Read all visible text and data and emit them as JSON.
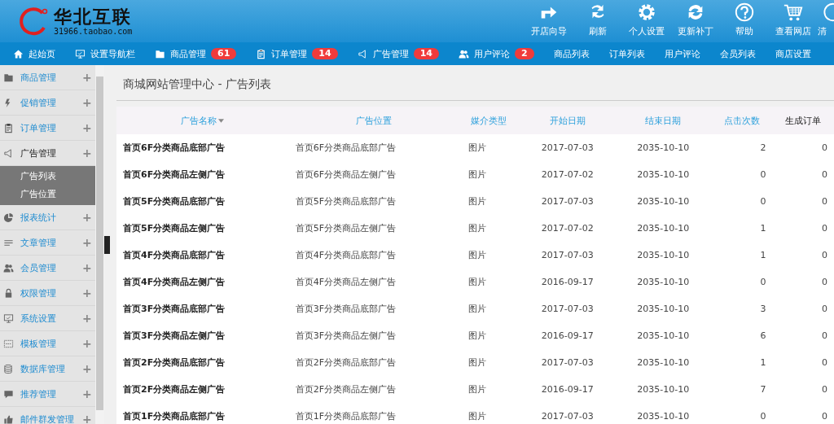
{
  "logo": {
    "name": "华北互联",
    "subtitle": "31966.taobao.com"
  },
  "toolbar": [
    {
      "kind": "guide",
      "label": "开店向导"
    },
    {
      "kind": "refresh",
      "label": "刷新"
    },
    {
      "kind": "settings",
      "label": "个人设置"
    },
    {
      "kind": "update",
      "label": "更新补丁"
    },
    {
      "kind": "help",
      "label": "帮助"
    },
    {
      "kind": "cart",
      "label": "查看网店"
    },
    {
      "kind": "clear",
      "label": "清"
    }
  ],
  "nav": [
    {
      "kind": "home",
      "label": "起始页"
    },
    {
      "kind": "screen",
      "label": "设置导航栏"
    },
    {
      "kind": "folder",
      "label": "商品管理",
      "badge": "61"
    },
    {
      "kind": "clipboard",
      "label": "订单管理",
      "badge": "14"
    },
    {
      "kind": "speaker",
      "label": "广告管理",
      "badge": "14"
    },
    {
      "kind": "users",
      "label": "用户评论",
      "badge": "2"
    },
    {
      "kind": "none",
      "label": "商品列表"
    },
    {
      "kind": "none",
      "label": "订单列表"
    },
    {
      "kind": "none",
      "label": "用户评论"
    },
    {
      "kind": "none",
      "label": "会员列表"
    },
    {
      "kind": "none",
      "label": "商店设置"
    }
  ],
  "sidebar": {
    "items": [
      {
        "kind": "folder",
        "label": "商品管理",
        "expanded": false
      },
      {
        "kind": "bolt",
        "label": "促销管理",
        "expanded": false
      },
      {
        "kind": "clipboard",
        "label": "订单管理",
        "expanded": false
      },
      {
        "kind": "speaker",
        "label": "广告管理",
        "expanded": true,
        "children": [
          {
            "label": "广告列表"
          },
          {
            "label": "广告位置"
          }
        ]
      },
      {
        "kind": "pie",
        "label": "报表统计",
        "expanded": false
      },
      {
        "kind": "lines",
        "label": "文章管理",
        "expanded": false
      },
      {
        "kind": "users",
        "label": "会员管理",
        "expanded": false
      },
      {
        "kind": "lock",
        "label": "权限管理",
        "expanded": false
      },
      {
        "kind": "screen",
        "label": "系统设置",
        "expanded": false
      },
      {
        "kind": "template",
        "label": "模板管理",
        "expanded": false
      },
      {
        "kind": "database",
        "label": "数据库管理",
        "expanded": false
      },
      {
        "kind": "chat",
        "label": "推荐管理",
        "expanded": false
      },
      {
        "kind": "thumb",
        "label": "邮件群发管理",
        "expanded": false
      }
    ],
    "toggle": "+"
  },
  "breadcrumb": "商城网站管理中心 - 广告列表",
  "table": {
    "columns": [
      {
        "label": "广告名称",
        "link": true,
        "sorted": true
      },
      {
        "label": "广告位置",
        "link": true,
        "sorted": false
      },
      {
        "label": "媒介类型",
        "link": true,
        "sorted": false
      },
      {
        "label": "开始日期",
        "link": true,
        "sorted": false
      },
      {
        "label": "结束日期",
        "link": true,
        "sorted": false
      },
      {
        "label": "点击次数",
        "link": true,
        "sorted": false
      },
      {
        "label": "生成订单",
        "link": false,
        "sorted": false
      }
    ],
    "rows": [
      [
        "首页6F分类商品底部广告",
        "首页6F分类商品底部广告",
        "图片",
        "2017-07-03",
        "2035-10-10",
        "2",
        "0"
      ],
      [
        "首页6F分类商品左侧广告",
        "首页6F分类商品左侧广告",
        "图片",
        "2017-07-02",
        "2035-10-10",
        "0",
        "0"
      ],
      [
        "首页5F分类商品底部广告",
        "首页5F分类商品底部广告",
        "图片",
        "2017-07-03",
        "2035-10-10",
        "0",
        "0"
      ],
      [
        "首页5F分类商品左侧广告",
        "首页5F分类商品左侧广告",
        "图片",
        "2017-07-02",
        "2035-10-10",
        "1",
        "0"
      ],
      [
        "首页4F分类商品底部广告",
        "首页4F分类商品底部广告",
        "图片",
        "2017-07-03",
        "2035-10-10",
        "1",
        "0"
      ],
      [
        "首页4F分类商品左侧广告",
        "首页4F分类商品左侧广告",
        "图片",
        "2016-09-17",
        "2035-10-10",
        "0",
        "0"
      ],
      [
        "首页3F分类商品底部广告",
        "首页3F分类商品底部广告",
        "图片",
        "2017-07-03",
        "2035-10-10",
        "3",
        "0"
      ],
      [
        "首页3F分类商品左侧广告",
        "首页3F分类商品左侧广告",
        "图片",
        "2016-09-17",
        "2035-10-10",
        "6",
        "0"
      ],
      [
        "首页2F分类商品底部广告",
        "首页2F分类商品底部广告",
        "图片",
        "2017-07-03",
        "2035-10-10",
        "1",
        "0"
      ],
      [
        "首页2F分类商品左侧广告",
        "首页2F分类商品左侧广告",
        "图片",
        "2016-09-17",
        "2035-10-10",
        "7",
        "0"
      ],
      [
        "首页1F分类商品底部广告",
        "首页1F分类商品底部广告",
        "图片",
        "2017-07-03",
        "2035-10-10",
        "0",
        "0"
      ]
    ]
  }
}
